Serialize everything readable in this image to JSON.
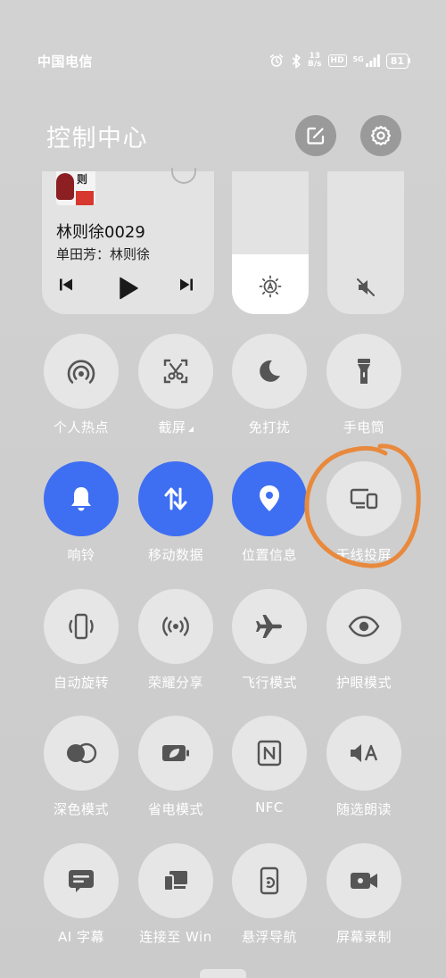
{
  "status_bar": {
    "carrier": "中国电信",
    "net_speed_value": "13",
    "net_speed_unit": "B/s",
    "hd_label": "HD",
    "network_label": "5G",
    "battery": "81"
  },
  "header": {
    "title": "控制中心"
  },
  "media": {
    "album_text": "则",
    "song": "林则徐0029",
    "artist": "单田芳：林则徐"
  },
  "sliders": {
    "brightness_level": 0.42,
    "volume_muted": true
  },
  "tiles": [
    {
      "label": "个人热点",
      "icon": "hotspot-icon",
      "active": false
    },
    {
      "label": "截屏",
      "icon": "screenshot-icon",
      "active": false
    },
    {
      "label": "免打扰",
      "icon": "moon-icon",
      "active": false
    },
    {
      "label": "手电筒",
      "icon": "flashlight-icon",
      "active": false
    },
    {
      "label": "响铃",
      "icon": "bell-icon",
      "active": true
    },
    {
      "label": "移动数据",
      "icon": "mobile-data-icon",
      "active": true
    },
    {
      "label": "位置信息",
      "icon": "location-icon",
      "active": true
    },
    {
      "label": "无线投屏",
      "icon": "screen-cast-icon",
      "active": false
    },
    {
      "label": "自动旋转",
      "icon": "auto-rotate-icon",
      "active": false
    },
    {
      "label": "荣耀分享",
      "icon": "share-icon",
      "active": false
    },
    {
      "label": "飞行模式",
      "icon": "airplane-icon",
      "active": false
    },
    {
      "label": "护眼模式",
      "icon": "eye-icon",
      "active": false
    },
    {
      "label": "深色模式",
      "icon": "dark-mode-icon",
      "active": false
    },
    {
      "label": "省电模式",
      "icon": "battery-saver-icon",
      "active": false
    },
    {
      "label": "NFC",
      "icon": "nfc-icon",
      "active": false
    },
    {
      "label": "随选朗读",
      "icon": "read-aloud-icon",
      "active": false
    },
    {
      "label": "AI 字幕",
      "icon": "subtitle-icon",
      "active": false
    },
    {
      "label": "连接至 Win",
      "icon": "connect-win-icon",
      "active": false
    },
    {
      "label": "悬浮导航",
      "icon": "floating-nav-icon",
      "active": false
    },
    {
      "label": "屏幕录制",
      "icon": "screen-record-icon",
      "active": false
    }
  ],
  "colors": {
    "active": "#3e6ef2",
    "tile": "#e6e6e6",
    "annotation": "#e8893d"
  }
}
